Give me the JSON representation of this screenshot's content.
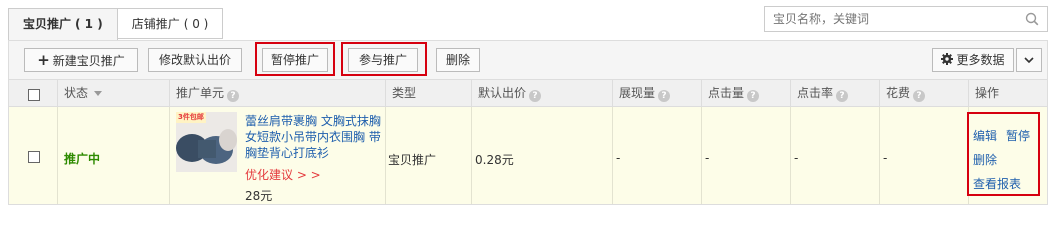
{
  "tabs": [
    {
      "label": "宝贝推广",
      "count": "( 1 )"
    },
    {
      "label": "店铺推广",
      "count": "( 0 )"
    }
  ],
  "search": {
    "placeholder": "宝贝名称，关键词"
  },
  "toolbar": {
    "new_label": "新建宝贝推广",
    "modify_bid_label": "修改默认出价",
    "pause_label": "暂停推广",
    "join_label": "参与推广",
    "delete_label": "删除",
    "more_data_label": "更多数据"
  },
  "table": {
    "headers": [
      "状态",
      "推广单元",
      "类型",
      "默认出价",
      "展现量",
      "点击量",
      "点击率",
      "花费",
      "操作"
    ],
    "rows": [
      {
        "status": "推广中",
        "thumb_badge": "3件包邮",
        "title": "蕾丝肩带裹胸 文胸式抹胸女短款小吊带内衣围胸 带胸垫背心打底衫",
        "advice": "优化建议 > >",
        "price": "28元",
        "type": "宝贝推广",
        "default_bid": "0.28元",
        "impressions": "-",
        "clicks": "-",
        "ctr": "-",
        "cost": "-",
        "ops": [
          "编辑",
          "暂停",
          "删除",
          "查看报表"
        ]
      }
    ]
  },
  "colors": {
    "accent_red": "#d6000f",
    "link_blue": "#1f5fad",
    "status_green": "#2e8b00",
    "advice_red": "#e4393c"
  }
}
